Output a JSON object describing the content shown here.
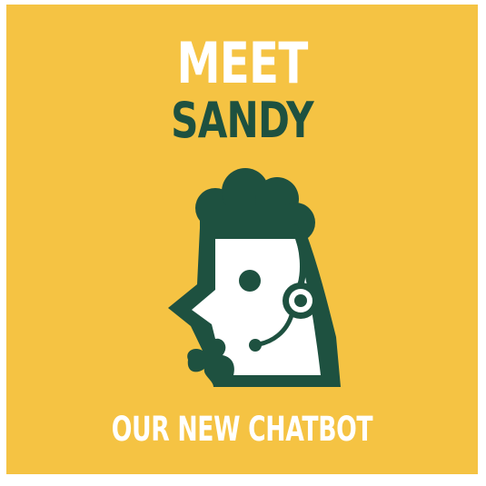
{
  "promo": {
    "headline_line1": "MEET",
    "headline_line2": "SANDY",
    "tagline": "OUR NEW CHATBOT"
  },
  "colors": {
    "background": "#f5c343",
    "accent_dark_green": "#1e5140",
    "text_white": "#ffffff"
  },
  "mascot": {
    "icon": "rooster-with-headset-icon"
  }
}
